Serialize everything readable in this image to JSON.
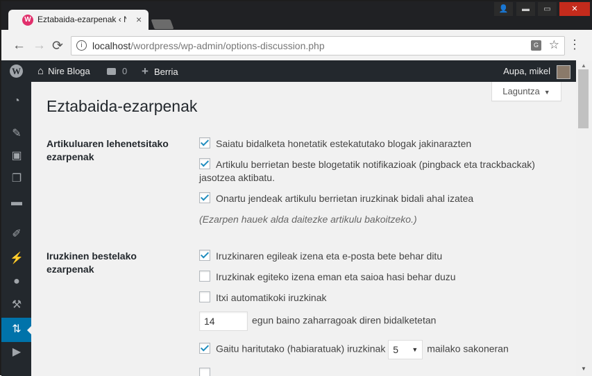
{
  "browser": {
    "tab_title": "Eztabaida-ezarpenak ‹ Nire",
    "tab_close": "×",
    "url_host": "localhost",
    "url_path": "/wordpress/wp-admin/options-discussion.php",
    "back_glyph": "←",
    "forward_glyph": "→",
    "reload_glyph": "⟳",
    "star_glyph": "☆",
    "menu_glyph": "⋮",
    "window_controls": {
      "minimize": "▬",
      "maximize": "▭",
      "close": "✕",
      "user": "👤"
    }
  },
  "adminbar": {
    "site_name": "Nire Bloga",
    "comments_count": "0",
    "new_label": "Berria",
    "greeting": "Aupa, mikel"
  },
  "sidebar": {
    "icons": [
      "dashboard-icon",
      "posts-icon",
      "media-icon",
      "pages-icon",
      "comments-icon",
      "appearance-icon",
      "plugins-icon",
      "users-icon",
      "tools-icon",
      "settings-icon",
      "collapse-icon"
    ],
    "active": "settings-icon"
  },
  "page": {
    "help_label": "Laguntza",
    "title": "Eztabaida-ezarpenak",
    "section1": {
      "heading": "Artikuluaren lehenetsitako ezarpenak",
      "opt1": "Saiatu bidalketa honetatik estekatutako blogak jakinarazten",
      "opt2": "Artikulu berrietan beste blogetatik notifikazioak (pingback eta trackbackak) jasotzea aktibatu.",
      "opt3": "Onartu jendeak artikulu berrietan iruzkinak bidali ahal izatea",
      "note": "(Ezarpen hauek alda daitezke artikulu bakoitzeko.)"
    },
    "section2": {
      "heading": "Iruzkinen bestelako ezarpenak",
      "opt1": "Iruzkinaren egileak izena eta e-posta bete behar ditu",
      "opt2": "Iruzkinak egiteko izena eman eta saioa hasi behar duzu",
      "opt3": "Itxi automatikoki iruzkinak",
      "days_value": "14",
      "days_suffix": "egun baino zaharragoak diren bidalketetan",
      "threaded_prefix": "Gaitu haritutako (habiaratuak) iruzkinak",
      "depth_value": "5",
      "threaded_suffix": "mailako sakoneran"
    }
  },
  "colors": {
    "adminbar_bg": "#23282d",
    "active_menu": "#0073aa",
    "content_bg": "#f1f1f1",
    "checkmark": "#1e8cbe"
  }
}
